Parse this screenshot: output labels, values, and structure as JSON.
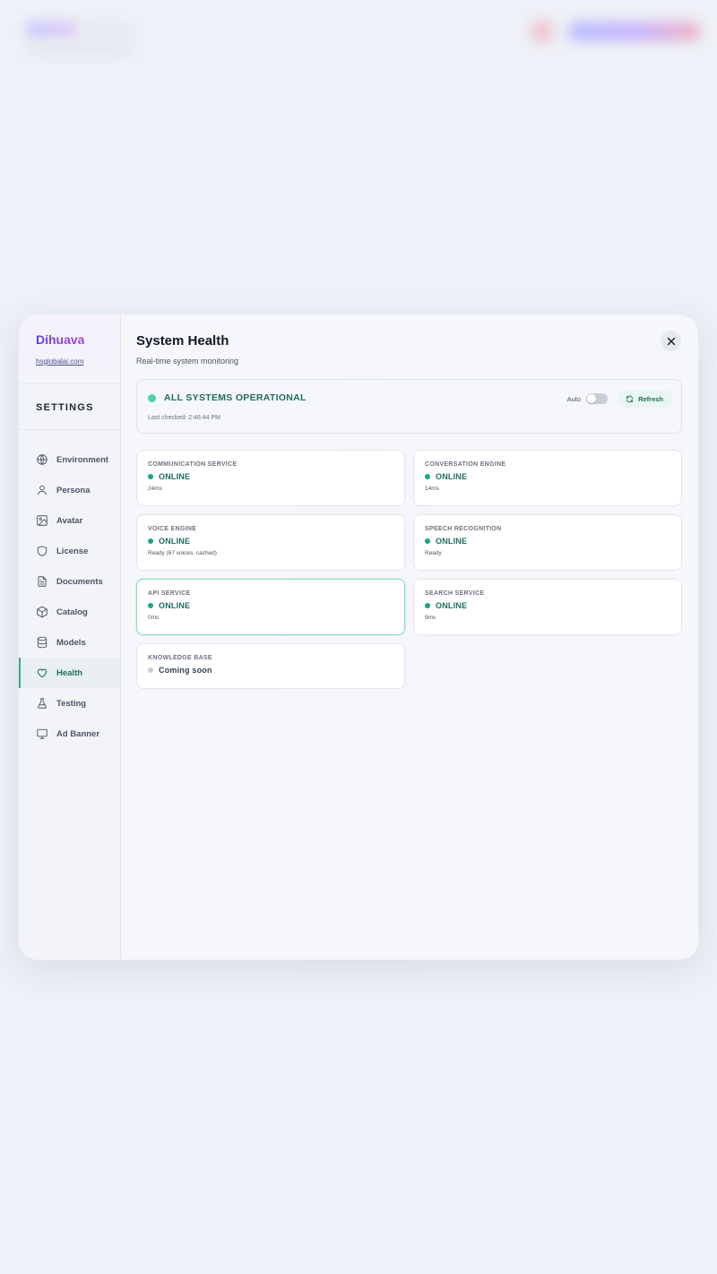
{
  "sidebar": {
    "brand": "Dihuava",
    "url": "hsglobalai.com",
    "heading": "SETTINGS",
    "items": [
      {
        "label": "Environment",
        "icon": "globe-icon"
      },
      {
        "label": "Persona",
        "icon": "user-icon"
      },
      {
        "label": "Avatar",
        "icon": "image-icon"
      },
      {
        "label": "License",
        "icon": "shield-icon"
      },
      {
        "label": "Documents",
        "icon": "document-icon"
      },
      {
        "label": "Catalog",
        "icon": "box-icon"
      },
      {
        "label": "Models",
        "icon": "database-icon"
      },
      {
        "label": "Health",
        "icon": "heart-icon",
        "active": true
      },
      {
        "label": "Testing",
        "icon": "flask-icon"
      },
      {
        "label": "Ad Banner",
        "icon": "monitor-icon"
      }
    ]
  },
  "header": {
    "title": "System Health",
    "subtitle": "Real-time system monitoring",
    "close_icon": "close-icon"
  },
  "overall": {
    "status": "ALL SYSTEMS OPERATIONAL",
    "last_checked": "Last checked: 2:46:44 PM",
    "auto_label": "Auto",
    "auto_enabled": false,
    "refresh_label": "Refresh"
  },
  "services": [
    {
      "name": "COMMUNICATION SERVICE",
      "status": "ONLINE",
      "detail": "24ms"
    },
    {
      "name": "CONVERSATION ENGINE",
      "status": "ONLINE",
      "detail": "14ms"
    },
    {
      "name": "VOICE ENGINE",
      "status": "ONLINE",
      "detail": "Ready (67 voices, cached)"
    },
    {
      "name": "SPEECH RECOGNITION",
      "status": "ONLINE",
      "detail": "Ready"
    },
    {
      "name": "API SERVICE",
      "status": "ONLINE",
      "detail": "0ms"
    },
    {
      "name": "SEARCH SERVICE",
      "status": "ONLINE",
      "detail": "9ms"
    },
    {
      "name": "KNOWLEDGE BASE",
      "status": "Coming soon",
      "detail": ""
    }
  ],
  "colors": {
    "accent": "#1f6e5c",
    "online_dot": "#1ea386",
    "brand_start": "#5b3ee0",
    "brand_end": "#a548c9",
    "pending_dot": "#c7cbd3"
  }
}
